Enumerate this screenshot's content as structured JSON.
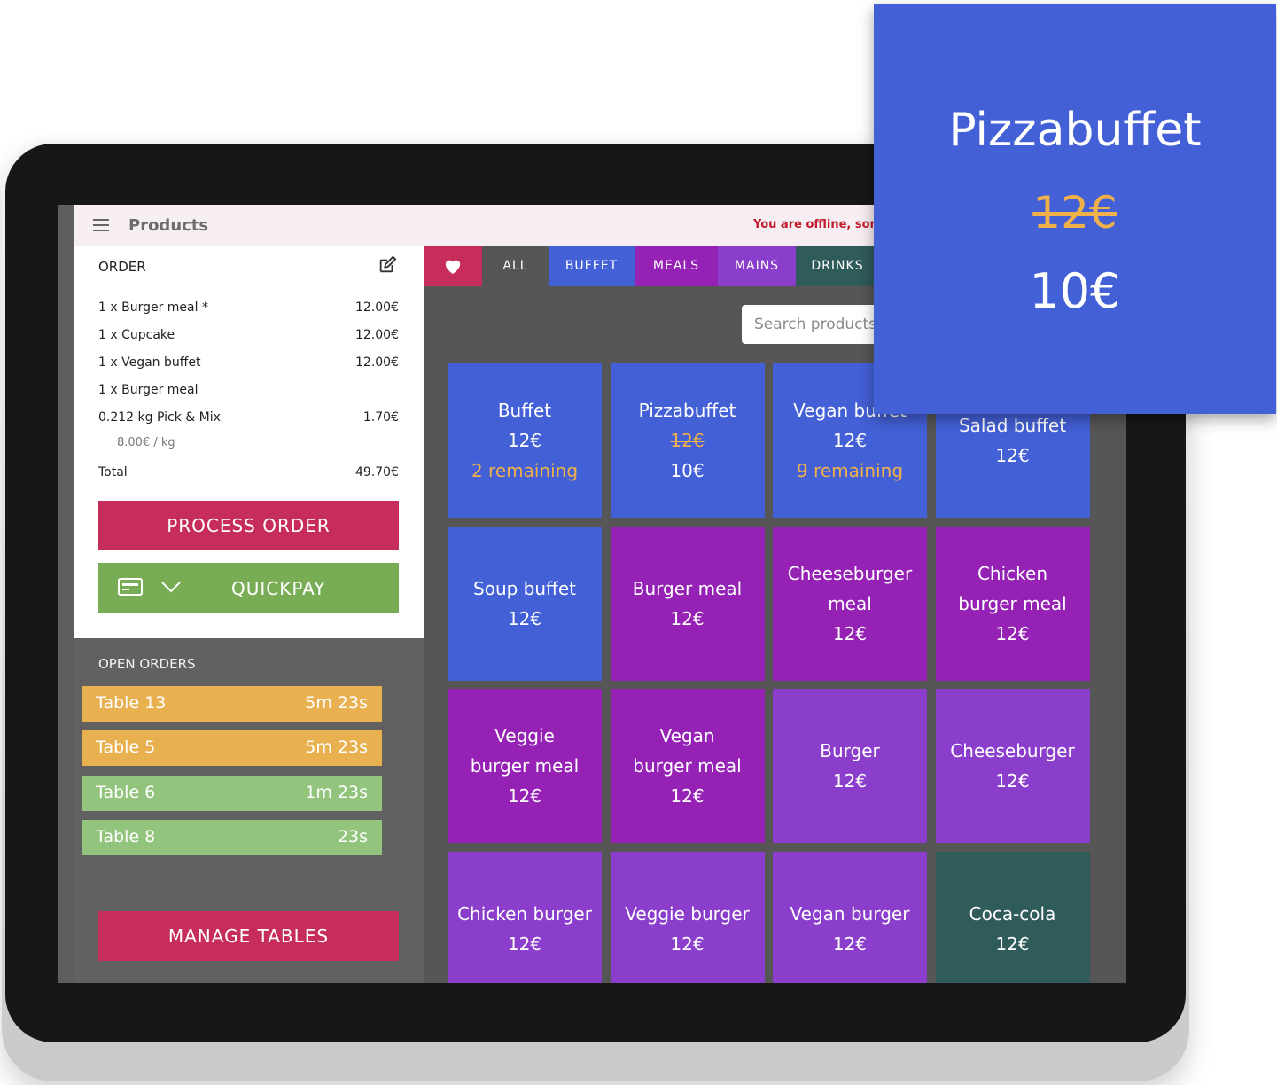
{
  "header": {
    "title": "Products",
    "offline_notice": "You are offline, some"
  },
  "order": {
    "title": "ORDER",
    "lines": [
      {
        "item": "1 x Burger meal *",
        "price": "12.00€"
      },
      {
        "item": "1 x Cupcake",
        "price": "12.00€"
      },
      {
        "item": "1 x Vegan buffet",
        "price": "12.00€"
      },
      {
        "item": "1 x Burger meal",
        "price": ""
      },
      {
        "item": "0.212 kg Pick & Mix",
        "price": "1.70€"
      }
    ],
    "unit_price": "8.00€ / kg",
    "total_label": "Total",
    "total_value": "49.70€",
    "process_label": "PROCESS ORDER",
    "quickpay_label": "QUICKPAY"
  },
  "open_orders": {
    "title": "OPEN ORDERS",
    "rows": [
      {
        "name": "Table 13",
        "time": "5m 23s",
        "color": "#e9b04f"
      },
      {
        "name": "Table 5",
        "time": "5m 23s",
        "color": "#e9b04f"
      },
      {
        "name": "Table 6",
        "time": "1m 23s",
        "color": "#93c47d"
      },
      {
        "name": "Table 8",
        "time": "23s",
        "color": "#93c47d"
      }
    ],
    "manage_label": "MANAGE TABLES"
  },
  "tabs": [
    {
      "label": "ALL",
      "color": "#565656"
    },
    {
      "label": "BUFFET",
      "color": "#4360d6"
    },
    {
      "label": "MEALS",
      "color": "#9522b5"
    },
    {
      "label": "MAINS",
      "color": "#8a3ecb"
    },
    {
      "label": "DRINKS",
      "color": "#2f5b5a"
    }
  ],
  "search": {
    "placeholder": "Search products"
  },
  "products": [
    {
      "lines": [
        "Buffet"
      ],
      "price": "12€",
      "extra": "2 remaining",
      "color": "#4360d6"
    },
    {
      "lines": [
        "Pizzabuffet"
      ],
      "old": "12€",
      "price": "10€",
      "color": "#4360d6"
    },
    {
      "lines": [
        "Vegan buffet"
      ],
      "price": "12€",
      "extra": "9 remaining",
      "color": "#4360d6"
    },
    {
      "lines": [
        "Salad buffet"
      ],
      "price": "12€",
      "color": "#4360d6"
    },
    {
      "lines": [
        "Soup buffet"
      ],
      "price": "12€",
      "color": "#4360d6"
    },
    {
      "lines": [
        "Burger meal"
      ],
      "price": "12€",
      "color": "#9522b5"
    },
    {
      "lines": [
        "Cheeseburger",
        "meal"
      ],
      "price": "12€",
      "color": "#9522b5"
    },
    {
      "lines": [
        "Chicken",
        "burger meal"
      ],
      "price": "12€",
      "color": "#9522b5"
    },
    {
      "lines": [
        "Veggie",
        "burger meal"
      ],
      "price": "12€",
      "color": "#9522b5"
    },
    {
      "lines": [
        "Vegan",
        "burger meal"
      ],
      "price": "12€",
      "color": "#9522b5"
    },
    {
      "lines": [
        "Burger"
      ],
      "price": "12€",
      "color": "#8a3ecb"
    },
    {
      "lines": [
        "Cheeseburger"
      ],
      "price": "12€",
      "color": "#8a3ecb"
    },
    {
      "lines": [
        "Chicken burger"
      ],
      "price": "12€",
      "color": "#8a3ecb"
    },
    {
      "lines": [
        "Veggie burger"
      ],
      "price": "12€",
      "color": "#8a3ecb"
    },
    {
      "lines": [
        "Vegan burger"
      ],
      "price": "12€",
      "color": "#8a3ecb"
    },
    {
      "lines": [
        "Coca-cola"
      ],
      "price": "12€",
      "color": "#2f5b5a"
    }
  ],
  "zoom_callout": {
    "name": "Pizzabuffet",
    "old_price": "12€",
    "new_price": "10€"
  }
}
